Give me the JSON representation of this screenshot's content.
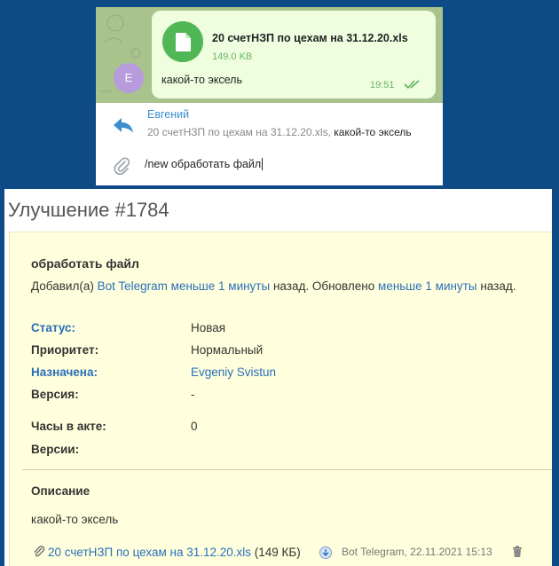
{
  "telegram": {
    "avatar_letter": "Е",
    "file_name": "20 счетНЗП по цехам на 31.12.20.xls",
    "file_size": "149.0 KB",
    "message": "какой-то эксель",
    "time": "19:51",
    "reply": {
      "name": "Евгений",
      "file_name": "20 счетНЗП по цехам на 31.12.20.xls,",
      "message": "какой-то эксель"
    },
    "input_text": "/new обработать файл"
  },
  "issue": {
    "title": "Улучшение #1784",
    "subject": "обработать файл",
    "meta": {
      "added_by_prefix": "Добавил(а)",
      "author": "Bot Telegram",
      "created_ago": "меньше 1 минуты",
      "ago_suffix_1": "назад. Обновлено",
      "updated_ago": "меньше 1 минуты",
      "ago_suffix_2": "назад."
    },
    "fields": {
      "status_label": "Статус:",
      "status_value": "Новая",
      "priority_label": "Приоритет:",
      "priority_value": "Нормальный",
      "assignee_label": "Назначена:",
      "assignee_value": "Evgeniy Svistun",
      "version_label": "Версия:",
      "version_value": "-",
      "hours_label": "Часы в акте:",
      "hours_value": "0",
      "versions_label": "Версии:"
    },
    "description_label": "Описание",
    "description_text": "какой-то эксель",
    "attachment": {
      "name": "20 счетНЗП по цехам на 31.12.20.xls",
      "size": "(149 КБ)",
      "author_date": "Bot Telegram, 22.11.2021 15:13"
    }
  },
  "colors": {
    "page_bg": "#0e4a86",
    "telegram_chat_bg": "#a9c38c",
    "bubble_bg": "#eefedf",
    "issue_box_bg": "#ffffdd",
    "link": "#2a6fba"
  }
}
